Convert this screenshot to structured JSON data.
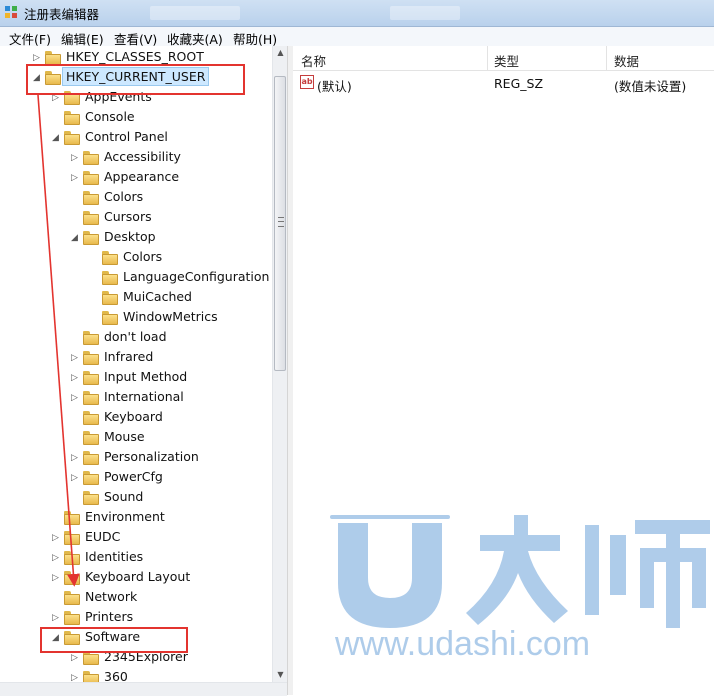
{
  "window": {
    "title": "注册表编辑器",
    "icon": "regedit-icon"
  },
  "menu": [
    "文件(F)",
    "编辑(E)",
    "查看(V)",
    "收藏夹(A)",
    "帮助(H)"
  ],
  "tree": [
    {
      "label": "HKEY_CLASSES_ROOT",
      "arrow": "▷"
    },
    {
      "label": "HKEY_CURRENT_USER",
      "arrow": "◢",
      "selected": true
    },
    {
      "label": "AppEvents",
      "arrow": "▷"
    },
    {
      "label": "Console",
      "arrow": ""
    },
    {
      "label": "Control Panel",
      "arrow": "◢"
    },
    {
      "label": "Accessibility",
      "arrow": "▷"
    },
    {
      "label": "Appearance",
      "arrow": "▷"
    },
    {
      "label": "Colors",
      "arrow": ""
    },
    {
      "label": "Cursors",
      "arrow": ""
    },
    {
      "label": "Desktop",
      "arrow": "◢"
    },
    {
      "label": "Colors",
      "arrow": ""
    },
    {
      "label": "LanguageConfiguration",
      "arrow": ""
    },
    {
      "label": "MuiCached",
      "arrow": ""
    },
    {
      "label": "WindowMetrics",
      "arrow": ""
    },
    {
      "label": "don't load",
      "arrow": ""
    },
    {
      "label": "Infrared",
      "arrow": "▷"
    },
    {
      "label": "Input Method",
      "arrow": "▷"
    },
    {
      "label": "International",
      "arrow": "▷"
    },
    {
      "label": "Keyboard",
      "arrow": ""
    },
    {
      "label": "Mouse",
      "arrow": ""
    },
    {
      "label": "Personalization",
      "arrow": "▷"
    },
    {
      "label": "PowerCfg",
      "arrow": "▷"
    },
    {
      "label": "Sound",
      "arrow": ""
    },
    {
      "label": "Environment",
      "arrow": ""
    },
    {
      "label": "EUDC",
      "arrow": "▷"
    },
    {
      "label": "Identities",
      "arrow": "▷"
    },
    {
      "label": "Keyboard Layout",
      "arrow": "▷"
    },
    {
      "label": "Network",
      "arrow": ""
    },
    {
      "label": "Printers",
      "arrow": "▷"
    },
    {
      "label": "Software",
      "arrow": "◢"
    },
    {
      "label": "2345Explorer",
      "arrow": "▷"
    },
    {
      "label": "360",
      "arrow": "▷"
    }
  ],
  "list": {
    "columns": [
      "名称",
      "类型",
      "数据"
    ],
    "rows": [
      {
        "name": "(默认)",
        "type": "REG_SZ",
        "data": "(数值未设置)",
        "icon": "string-value-icon"
      }
    ]
  },
  "watermark": {
    "brand": "U大师",
    "url": "www.udashi.com"
  },
  "colors": {
    "annotation": "#e3342f",
    "watermark": "#4d8fd1",
    "selection": "#cde8ff"
  }
}
